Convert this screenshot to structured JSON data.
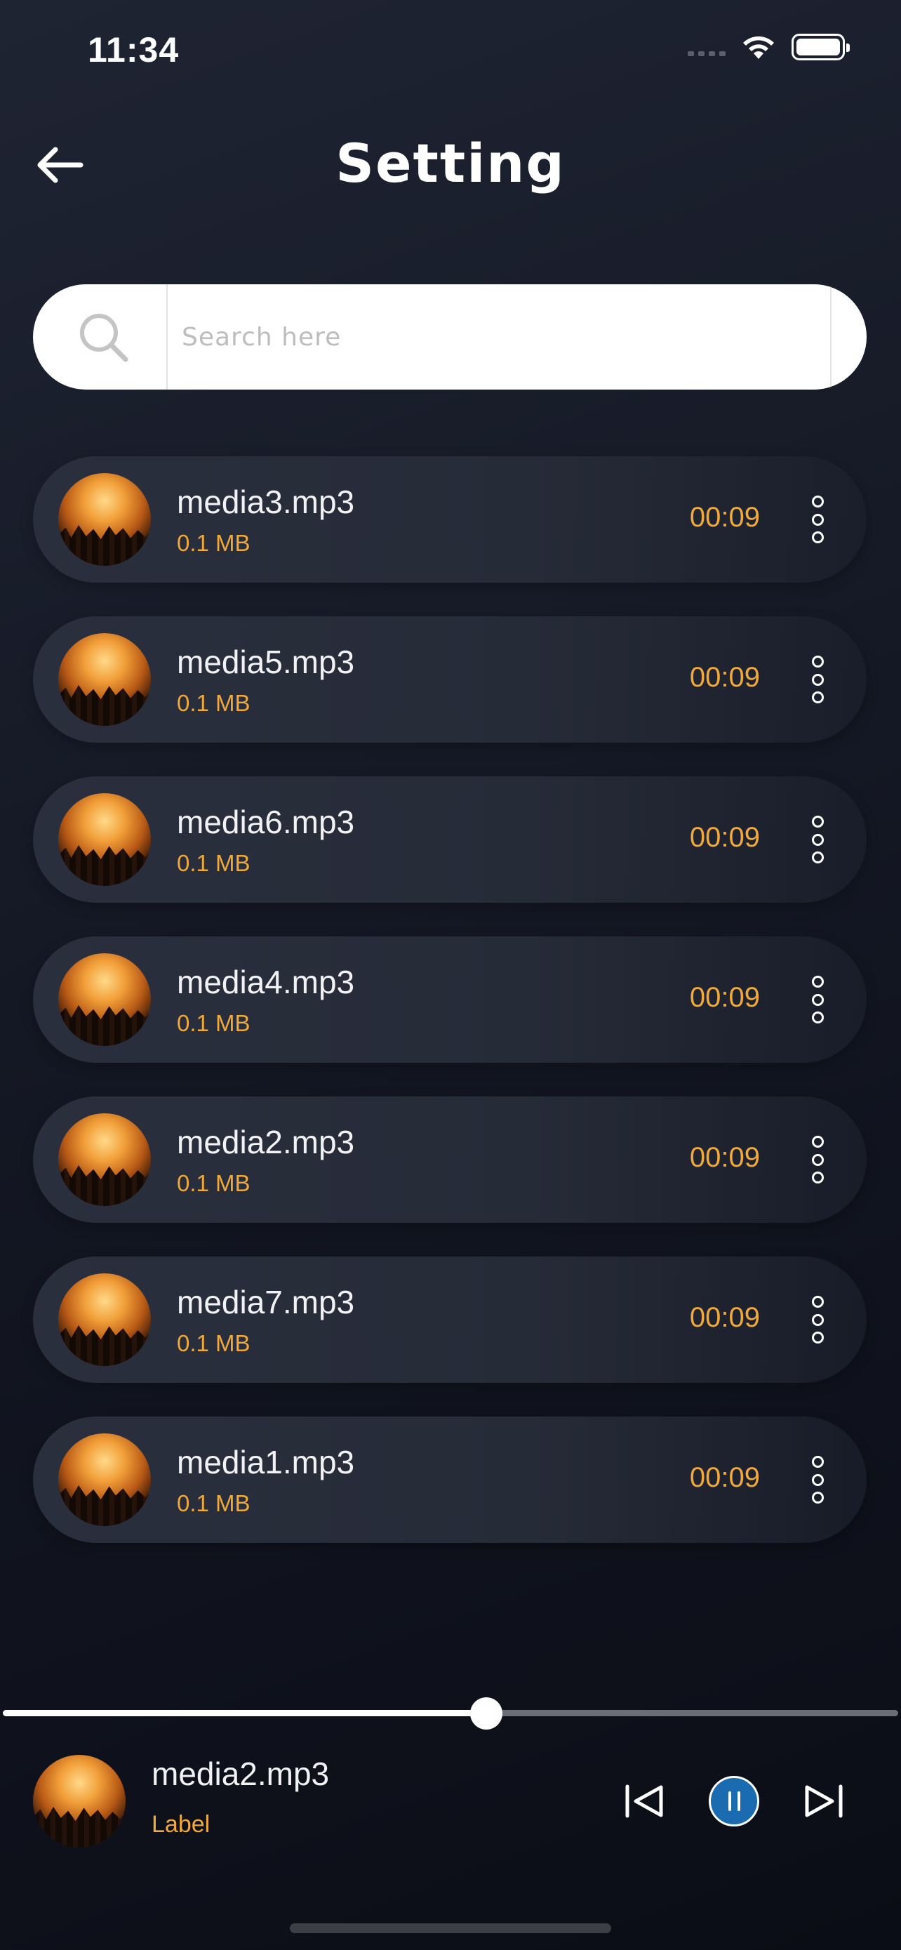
{
  "status_bar": {
    "time": "11:34"
  },
  "header": {
    "title": "Setting"
  },
  "search": {
    "placeholder": "Search here",
    "value": ""
  },
  "media_items": [
    {
      "name": "media3.mp3",
      "size": "0.1 MB",
      "duration": "00:09"
    },
    {
      "name": "media5.mp3",
      "size": "0.1 MB",
      "duration": "00:09"
    },
    {
      "name": "media6.mp3",
      "size": "0.1 MB",
      "duration": "00:09"
    },
    {
      "name": "media4.mp3",
      "size": "0.1 MB",
      "duration": "00:09"
    },
    {
      "name": "media2.mp3",
      "size": "0.1 MB",
      "duration": "00:09"
    },
    {
      "name": "media7.mp3",
      "size": "0.1 MB",
      "duration": "00:09"
    },
    {
      "name": "media1.mp3",
      "size": "0.1 MB",
      "duration": "00:09"
    }
  ],
  "player": {
    "title": "media2.mp3",
    "label": "Label",
    "progress": 0.54,
    "state": "playing"
  },
  "colors": {
    "accent": "#f0a93a",
    "pause_button": "#1a6bb0",
    "background": "#141824"
  },
  "icons": {
    "back": "arrow-left-icon",
    "search": "search-icon",
    "more": "more-vertical-icon",
    "previous": "skip-previous-icon",
    "pause": "pause-icon",
    "next": "skip-next-icon"
  }
}
